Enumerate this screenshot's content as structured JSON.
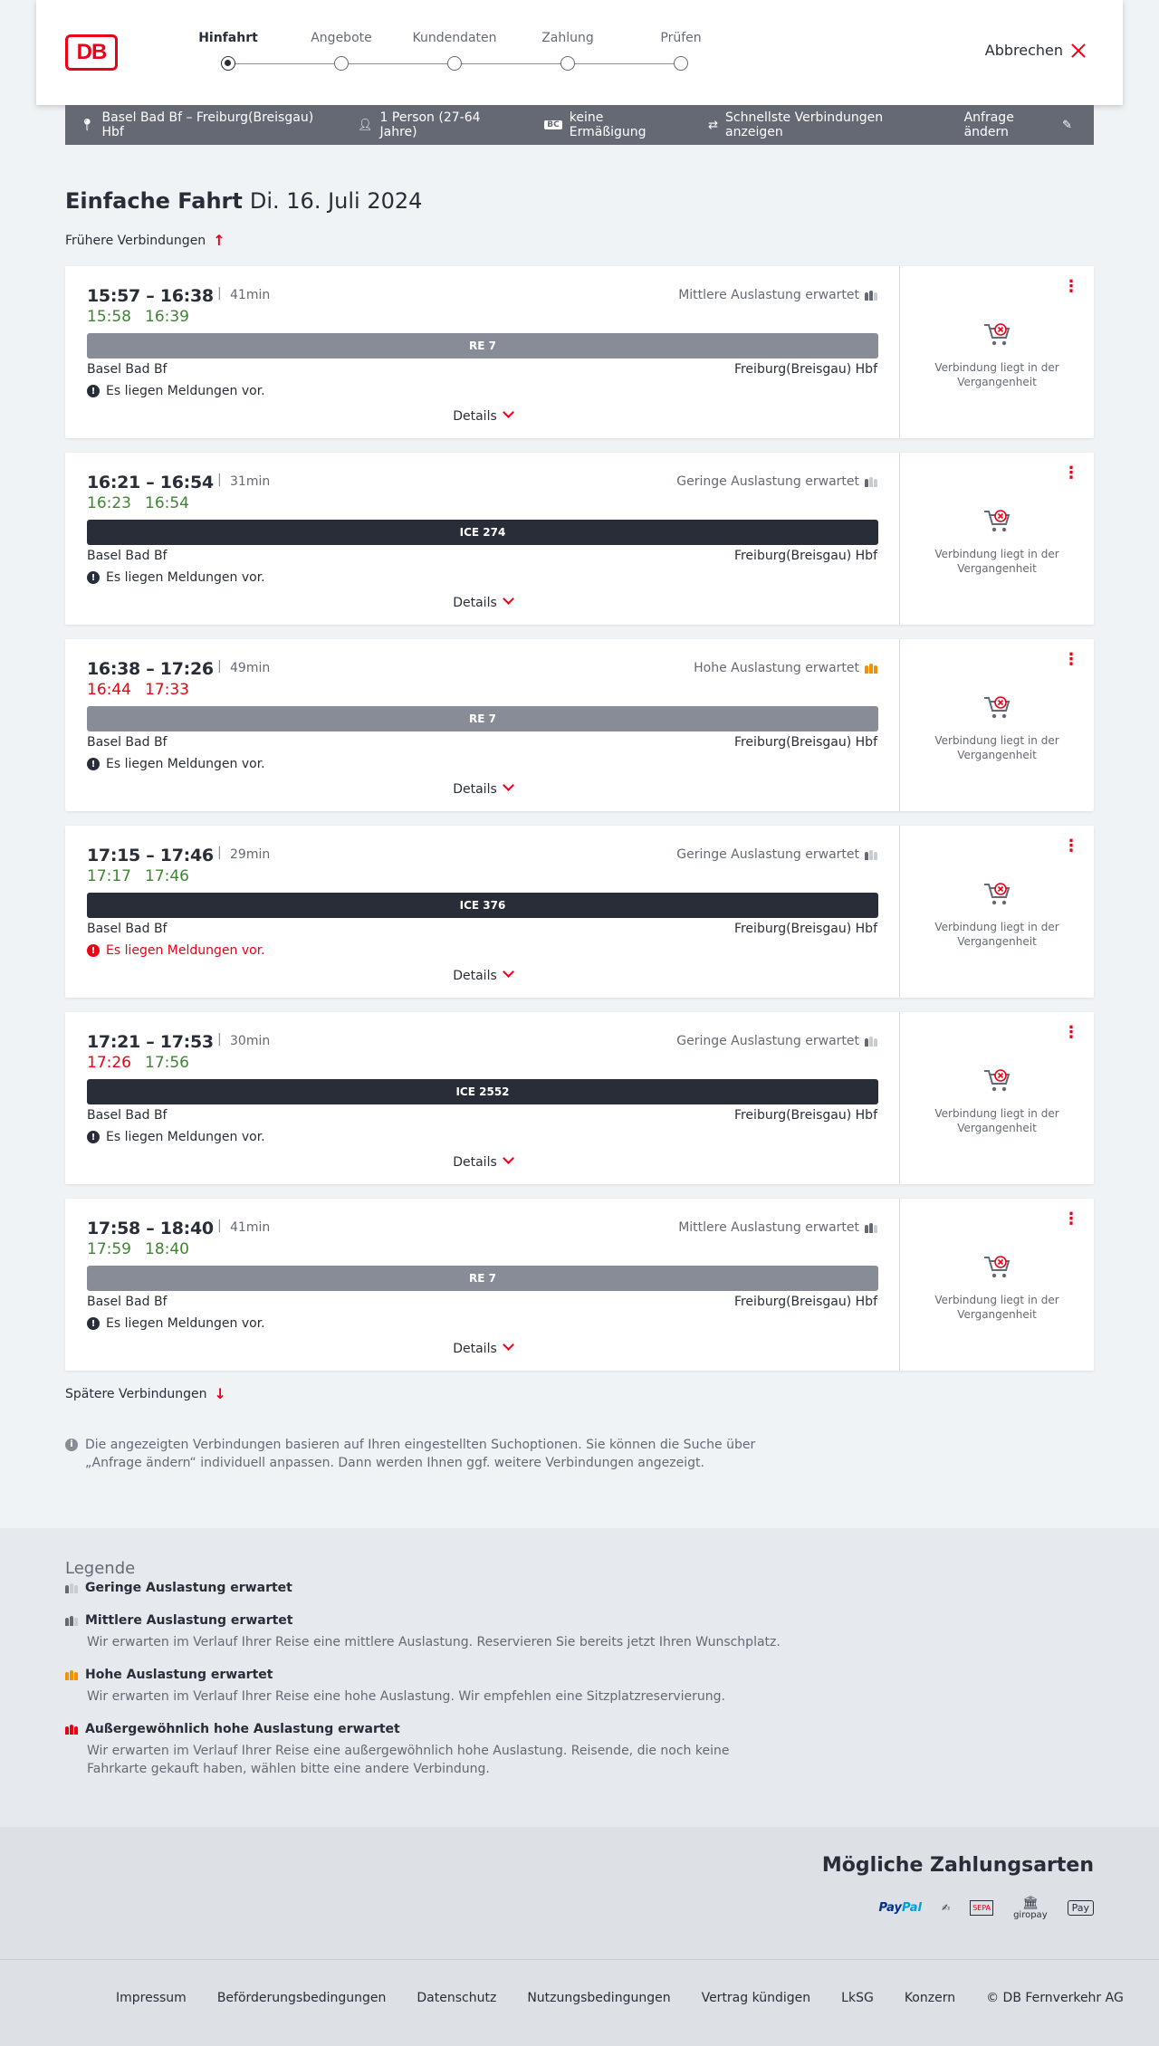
{
  "header": {
    "logo": "DB",
    "steps": [
      "Hinfahrt",
      "Angebote",
      "Kundendaten",
      "Zahlung",
      "Prüfen"
    ],
    "active_step": 0,
    "cancel_label": "Abbrechen"
  },
  "summary": {
    "route": "Basel Bad Bf – Freiburg(Breisgau) Hbf",
    "persons": "1 Person (27-64 Jahre)",
    "bahncard_badge": "BC",
    "discount": "keine Ermäßigung",
    "option": "Schnellste Verbindungen anzeigen",
    "edit_label": "Anfrage ändern"
  },
  "page": {
    "title": "Einfache Fahrt",
    "date": "Di. 16. Juli 2024",
    "earlier_label": "Frühere Verbindungen",
    "later_label": "Spätere Verbindungen",
    "info_text": "Die angezeigten Verbindungen basieren auf Ihren eingestellten Suchoptionen. Sie können die Suche über „Anfrage ändern“ individuell anpassen. Dann werden Ihnen ggf. weitere Verbindungen angezeigt."
  },
  "connections": [
    {
      "times": "15:57 – 16:38",
      "duration": "41min",
      "rt_dep": "15:58",
      "rt_arr": "16:39",
      "rt_dep_color": "green",
      "rt_arr_color": "green",
      "load": "Mittlere Auslastung erwartet",
      "load_level": 2,
      "train": "RE 7",
      "train_type": "re",
      "from": "Basel Bad Bf",
      "to": "Freiburg(Breisgau) Hbf",
      "message": "Es liegen Meldungen vor.",
      "message_warn": false,
      "details": "Details",
      "side": "Verbindung liegt in der Vergangenheit"
    },
    {
      "times": "16:21 – 16:54",
      "duration": "31min",
      "rt_dep": "16:23",
      "rt_arr": "16:54",
      "rt_dep_color": "green",
      "rt_arr_color": "green",
      "load": "Geringe Auslastung erwartet",
      "load_level": 1,
      "train": "ICE 274",
      "train_type": "ice",
      "from": "Basel Bad Bf",
      "to": "Freiburg(Breisgau) Hbf",
      "message": "Es liegen Meldungen vor.",
      "message_warn": false,
      "details": "Details",
      "side": "Verbindung liegt in der Vergangenheit"
    },
    {
      "times": "16:38 – 17:26",
      "duration": "49min",
      "rt_dep": "16:44",
      "rt_arr": "17:33",
      "rt_dep_color": "red",
      "rt_arr_color": "red",
      "load": "Hohe Auslastung erwartet",
      "load_level": 3,
      "train": "RE 7",
      "train_type": "re",
      "from": "Basel Bad Bf",
      "to": "Freiburg(Breisgau) Hbf",
      "message": "Es liegen Meldungen vor.",
      "message_warn": false,
      "details": "Details",
      "side": "Verbindung liegt in der Vergangenheit"
    },
    {
      "times": "17:15 – 17:46",
      "duration": "29min",
      "rt_dep": "17:17",
      "rt_arr": "17:46",
      "rt_dep_color": "green",
      "rt_arr_color": "green",
      "load": "Geringe Auslastung erwartet",
      "load_level": 1,
      "train": "ICE 376",
      "train_type": "ice",
      "from": "Basel Bad Bf",
      "to": "Freiburg(Breisgau) Hbf",
      "message": "Es liegen Meldungen vor.",
      "message_warn": true,
      "details": "Details",
      "side": "Verbindung liegt in der Vergangenheit"
    },
    {
      "times": "17:21 – 17:53",
      "duration": "30min",
      "rt_dep": "17:26",
      "rt_arr": "17:56",
      "rt_dep_color": "red",
      "rt_arr_color": "green",
      "load": "Geringe Auslastung erwartet",
      "load_level": 1,
      "train": "ICE 2552",
      "train_type": "ice",
      "from": "Basel Bad Bf",
      "to": "Freiburg(Breisgau) Hbf",
      "message": "Es liegen Meldungen vor.",
      "message_warn": false,
      "details": "Details",
      "side": "Verbindung liegt in der Vergangenheit"
    },
    {
      "times": "17:58 – 18:40",
      "duration": "41min",
      "rt_dep": "17:59",
      "rt_arr": "18:40",
      "rt_dep_color": "green",
      "rt_arr_color": "green",
      "load": "Mittlere Auslastung erwartet",
      "load_level": 2,
      "train": "RE 7",
      "train_type": "re",
      "from": "Basel Bad Bf",
      "to": "Freiburg(Breisgau) Hbf",
      "message": "Es liegen Meldungen vor.",
      "message_warn": false,
      "details": "Details",
      "side": "Verbindung liegt in der Vergangenheit"
    }
  ],
  "legend": {
    "title": "Legende",
    "items": [
      {
        "title": "Geringe Auslastung erwartet",
        "desc": "",
        "level": 1
      },
      {
        "title": "Mittlere Auslastung erwartet",
        "desc": "Wir erwarten im Verlauf Ihrer Reise eine mittlere Auslastung. Reservieren Sie bereits jetzt Ihren Wunschplatz.",
        "level": 2
      },
      {
        "title": "Hohe Auslastung erwartet",
        "desc": "Wir erwarten im Verlauf Ihrer Reise eine hohe Auslastung. Wir empfehlen eine Sitzplatzreservierung.",
        "level": 3
      },
      {
        "title": "Außergewöhnlich hohe Auslastung erwartet",
        "desc": "Wir erwarten im Verlauf Ihrer Reise eine außergewöhnlich hohe Auslastung. Reisende, die noch keine Fahrkarte gekauft haben, wählen bitte eine andere Verbindung.",
        "level": 4
      }
    ]
  },
  "payment": {
    "title": "Mögliche Zahlungsarten",
    "paypal_a": "Pay",
    "paypal_b": "Pal",
    "sepa": "SEPA",
    "giropay": "giropay",
    "applepay": "Pay"
  },
  "footer": {
    "links": [
      "Impressum",
      "Beförderungsbedingungen",
      "Datenschutz",
      "Nutzungsbedingungen",
      "Vertrag kündigen",
      "LkSG",
      "Konzern",
      "© DB Fernverkehr AG"
    ]
  },
  "colors": {
    "accent": "#ec0016",
    "on_time": "#408335",
    "delayed": "#ec0016",
    "high_load": "#f39200"
  }
}
